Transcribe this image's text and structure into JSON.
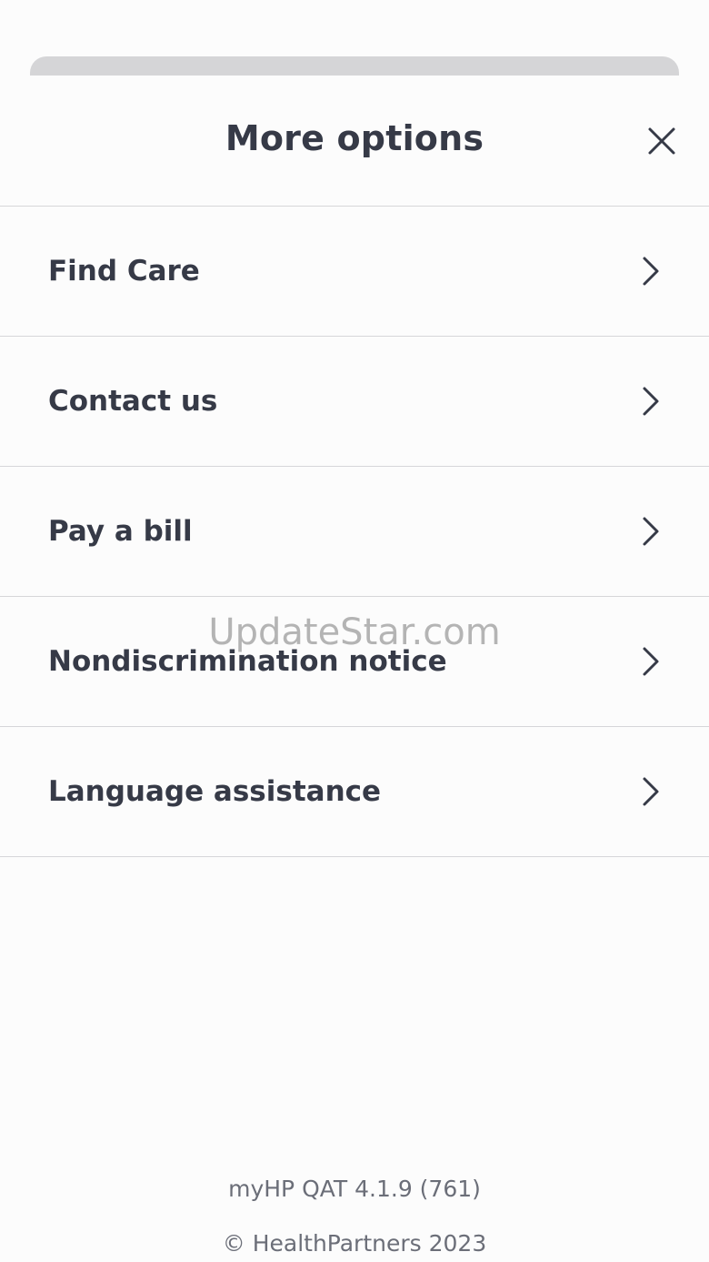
{
  "header": {
    "title": "More options",
    "close_icon": "close-icon"
  },
  "menu": {
    "items": [
      {
        "label": "Find Care",
        "icon": "chevron-right-icon"
      },
      {
        "label": "Contact us",
        "icon": "chevron-right-icon"
      },
      {
        "label": "Pay a bill",
        "icon": "chevron-right-icon"
      },
      {
        "label": "Nondiscrimination notice",
        "icon": "chevron-right-icon"
      },
      {
        "label": "Language assistance",
        "icon": "chevron-right-icon"
      }
    ]
  },
  "footer": {
    "version": "myHP QAT 4.1.9 (761)",
    "copyright": "© HealthPartners 2023"
  },
  "watermark": "UpdateStar.com",
  "colors": {
    "text": "#363a47",
    "divider": "#d6d6d9",
    "background": "#fcfcfc",
    "sheet_behind": "#d5d5d7"
  }
}
